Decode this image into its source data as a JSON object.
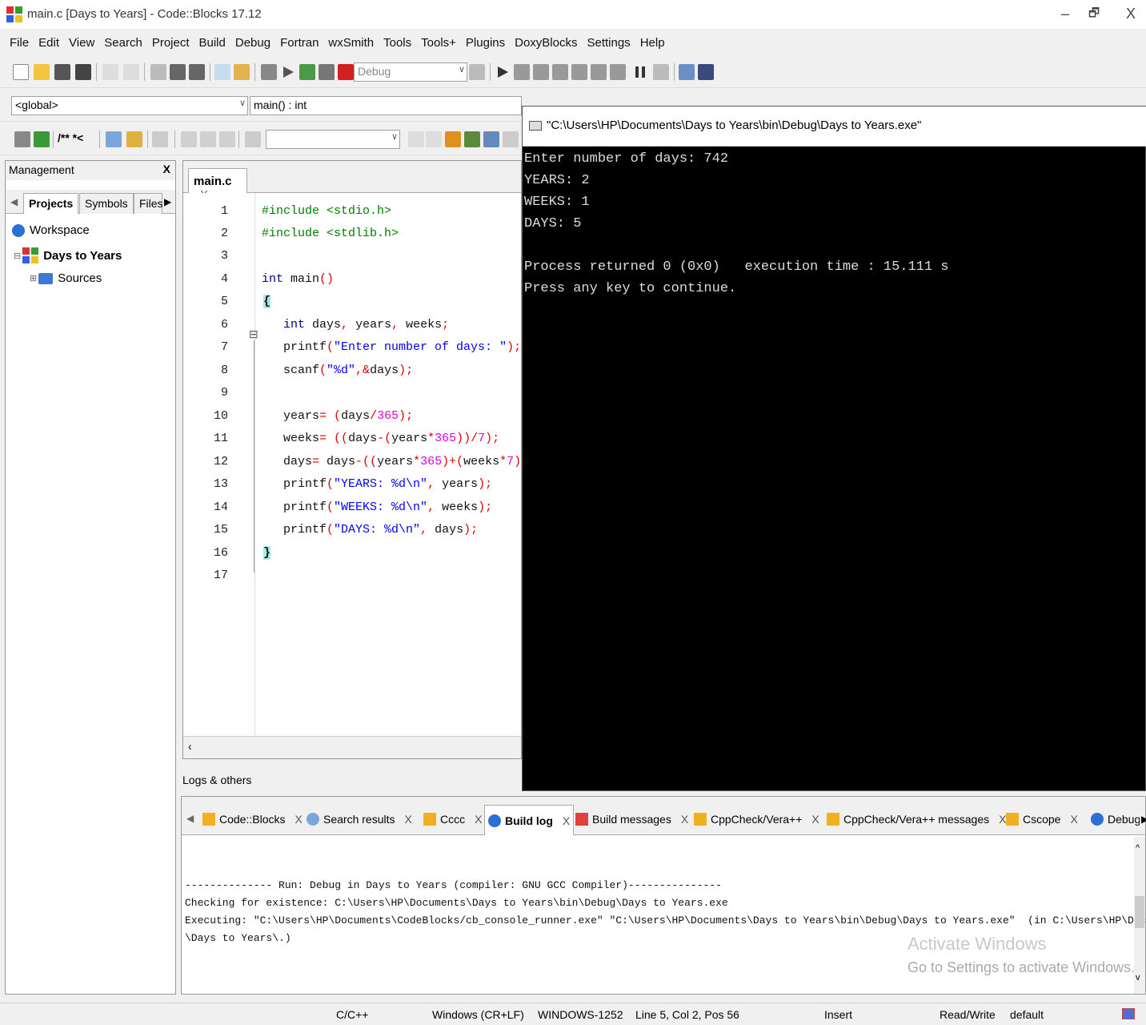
{
  "window": {
    "title": "main.c [Days to Years] - Code::Blocks 17.12",
    "minimize": "–",
    "maximize": "🗗",
    "close": "X"
  },
  "menu": [
    "File",
    "Edit",
    "View",
    "Search",
    "Project",
    "Build",
    "Debug",
    "Fortran",
    "wxSmith",
    "Tools",
    "Tools+",
    "Plugins",
    "DoxyBlocks",
    "Settings",
    "Help"
  ],
  "toolbar": {
    "build_target": "Debug",
    "scope": "<global>",
    "function": "main() : int",
    "search_value": "",
    "cmt_text": "/** *<"
  },
  "management": {
    "title": "Management",
    "close": "X",
    "tabs": [
      "Projects",
      "Symbols",
      "Files"
    ],
    "tree": {
      "workspace": "Workspace",
      "project": "Days to Years",
      "folder": "Sources"
    }
  },
  "editor": {
    "tab_label": "main.c",
    "tab_close": "X",
    "line_numbers": [
      "1",
      "2",
      "3",
      "4",
      "5",
      "6",
      "7",
      "8",
      "9",
      "10",
      "11",
      "12",
      "13",
      "14",
      "15",
      "16",
      "17"
    ],
    "fold_marker": "⊟"
  },
  "console": {
    "title": "\"C:\\Users\\HP\\Documents\\Days to Years\\bin\\Debug\\Days to Years.exe\"",
    "lines": [
      "Enter number of days: 742",
      "YEARS: 2",
      "WEEKS: 1",
      "DAYS: 5",
      "",
      "Process returned 0 (0x0)   execution time : 15.111 s",
      "Press any key to continue."
    ]
  },
  "logs": {
    "title": "Logs & others",
    "tabs": [
      "Code::Blocks",
      "Search results",
      "Cccc",
      "Build log",
      "Build messages",
      "CppCheck/Vera++",
      "CppCheck/Vera++ messages",
      "Cscope",
      "Debugger"
    ],
    "lines": [
      "-------------- Run: Debug in Days to Years (compiler: GNU GCC Compiler)---------------",
      "",
      "Checking for existence: C:\\Users\\HP\\Documents\\Days to Years\\bin\\Debug\\Days to Years.exe",
      "Executing: \"C:\\Users\\HP\\Documents\\CodeBlocks/cb_console_runner.exe\" \"C:\\Users\\HP\\Documents\\Days to Years\\bin\\Debug\\Days to Years.exe\"  (in C:\\Users\\HP\\Documents",
      "\\Days to Years\\.)"
    ]
  },
  "watermark": {
    "line1": "Activate Windows",
    "line2": "Go to Settings to activate Windows."
  },
  "status": {
    "language": "C/C++",
    "eol": "Windows (CR+LF)",
    "encoding": "WINDOWS-1252",
    "position": "Line 5, Col 2, Pos 56",
    "mode": "Insert",
    "access": "Read/Write",
    "profile": "default"
  }
}
